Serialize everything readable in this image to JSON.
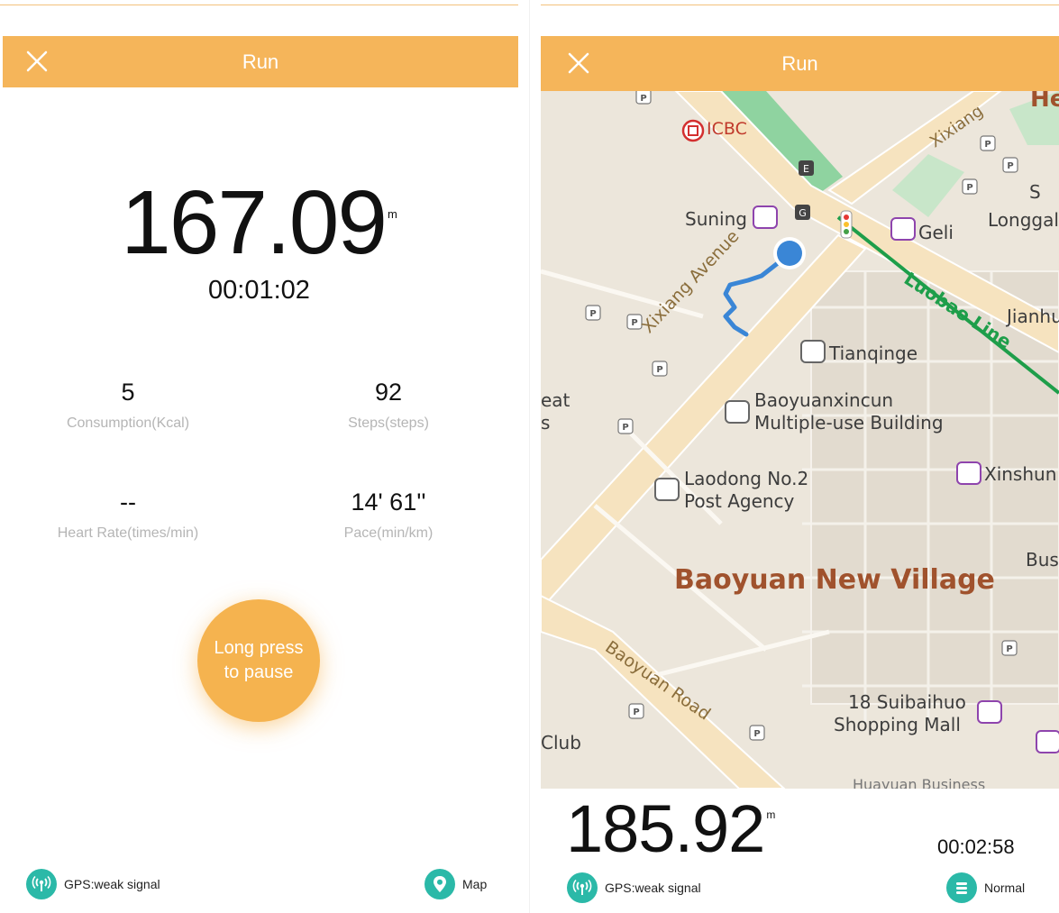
{
  "left": {
    "header": {
      "title": "Run"
    },
    "distance": {
      "value": "167.09",
      "unit": "m"
    },
    "duration": "00:01:02",
    "stats": [
      {
        "value": "5",
        "label": "Consumption(Kcal)"
      },
      {
        "value": "92",
        "label": "Steps(steps)"
      },
      {
        "value": "--",
        "label": "Heart Rate(times/min)"
      },
      {
        "value": "14' 61''",
        "label": "Pace(min/km)"
      }
    ],
    "pause_button": {
      "line1": "Long press",
      "line2": "to pause"
    },
    "gps": {
      "label": "GPS:weak signal"
    },
    "map_button": {
      "label": "Map"
    }
  },
  "right": {
    "header": {
      "title": "Run"
    },
    "map": {
      "labels": {
        "icbc": "ICBC",
        "suning": "Suning",
        "geli": "Geli",
        "longgal": "Longgal",
        "jianhu": "Jianhu",
        "tianqinge": "Tianqinge",
        "baoyuan_building_1": "Baoyuanxincun",
        "baoyuan_building_2": "Multiple-use Building",
        "xinshun": "Xinshun",
        "post_1": "Laodong No.2",
        "post_2": "Post Agency",
        "district": "Baoyuan New Village",
        "bus": "Bus",
        "mall_1": "18 Suibaihuo",
        "mall_2": "Shopping Mall",
        "club": "Club",
        "eat": "eat",
        "xixiang_avenue": "Xixiang Avenue",
        "baoyuan_road": "Baoyuan Road",
        "luobao_line": "Luobao Line",
        "xixiang_top": "Xixiang",
        "he": "He",
        "s_letter": "s",
        "s_letter2": "S",
        "huayuan": "Huayuan Business"
      }
    },
    "distance": {
      "value": "185.92",
      "unit": "m"
    },
    "duration": "00:02:58",
    "gps": {
      "label": "GPS:weak signal"
    },
    "normal_button": {
      "label": "Normal"
    }
  },
  "colors": {
    "accent": "#f5b55a",
    "teal": "#2bb9a8",
    "route": "#3a86d6",
    "metro": "#1e9e4a"
  }
}
